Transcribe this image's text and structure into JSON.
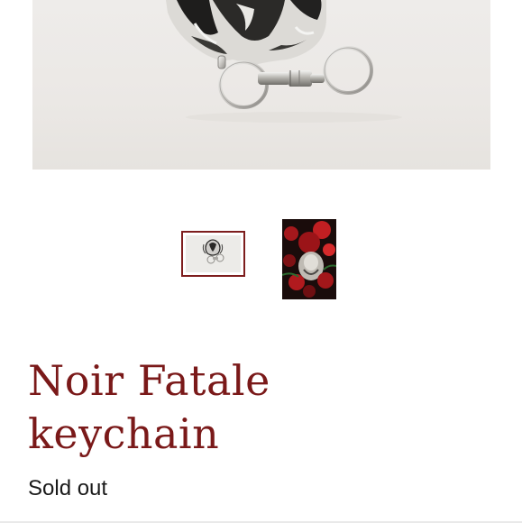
{
  "product": {
    "title_line1": "Noir Fatale",
    "title_line2": "keychain",
    "status": "Sold out"
  },
  "gallery": {
    "selected_index": 0,
    "thumbnails": [
      {
        "icon": "keychain-photo"
      },
      {
        "icon": "red-artwork-photo"
      }
    ]
  },
  "colors": {
    "title": "#7a1919",
    "selected_border": "#7d1d1d",
    "status_text": "#1a1a1a"
  }
}
